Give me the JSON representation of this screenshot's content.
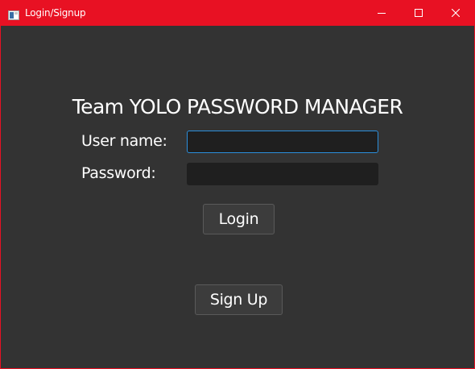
{
  "window": {
    "title": "Login/Signup",
    "controls": {
      "minimize": "minimize-icon",
      "maximize": "maximize-icon",
      "close": "close-icon"
    },
    "colors": {
      "titlebar": "#e81123",
      "background": "#333333",
      "field": "#1f1f1f",
      "focus_border": "#2b8fdc"
    }
  },
  "form": {
    "title": "Team YOLO PASSWORD MANAGER",
    "username_label": "User name:",
    "username_value": "",
    "password_label": "Password:",
    "password_value": "",
    "login_label": "Login",
    "signup_label": "Sign Up"
  }
}
